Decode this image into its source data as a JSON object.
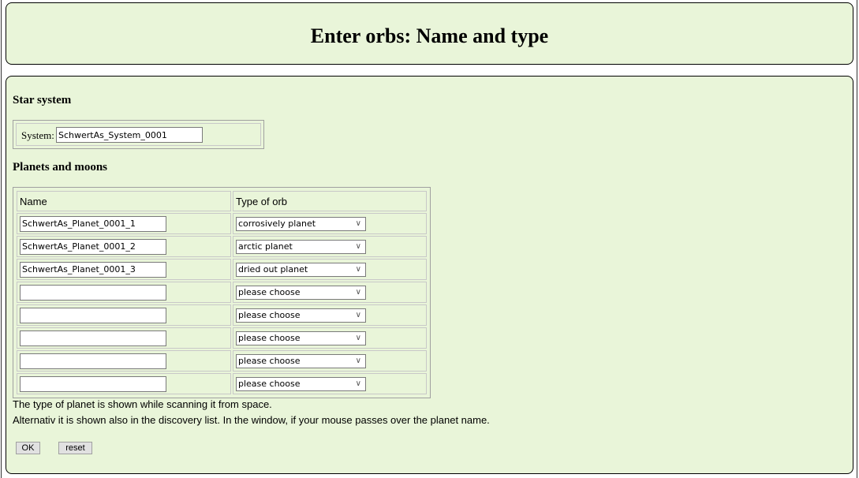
{
  "header": {
    "title": "Enter orbs: Name and type"
  },
  "star_system": {
    "section_title": "Star system",
    "system_label": "System:",
    "system_value": "SchwertAs_System_0001"
  },
  "planets": {
    "section_title": "Planets and moons",
    "columns": [
      "Name",
      "Type of orb"
    ],
    "rows": [
      {
        "name": "SchwertAs_Planet_0001_1",
        "type": "corrosively planet"
      },
      {
        "name": "SchwertAs_Planet_0001_2",
        "type": "arctic planet"
      },
      {
        "name": "SchwertAs_Planet_0001_3",
        "type": "dried out planet"
      },
      {
        "name": "",
        "type": "please choose"
      },
      {
        "name": "",
        "type": "please choose"
      },
      {
        "name": "",
        "type": "please choose"
      },
      {
        "name": "",
        "type": "please choose"
      },
      {
        "name": "",
        "type": "please choose"
      }
    ]
  },
  "notes": [
    "The type of planet is shown while scanning it from space.",
    "Alternativ it is shown also in the discovery list. In the window, if your mouse passes over the planet name."
  ],
  "buttons": {
    "ok": "OK",
    "reset": "reset"
  },
  "icons": {
    "dropdown": "chevron-down-icon"
  },
  "colors": {
    "panel_bg": "#e9f5d9",
    "panel_border": "#000000"
  }
}
